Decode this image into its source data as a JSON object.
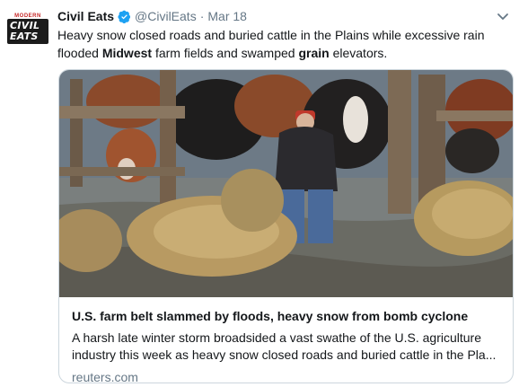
{
  "tweet": {
    "avatar": {
      "small_text": "MODERN",
      "logo_text": "CIVIL EATS"
    },
    "author_name": "Civil Eats",
    "handle": "@CivilEats",
    "separator": "·",
    "date": "Mar 18",
    "text_parts": [
      "Heavy snow closed roads and buried cattle in the Plains while excessive rain flooded ",
      "Midwest",
      " farm fields and swamped ",
      "grain",
      " elevators."
    ],
    "icons": {
      "verified": "verified-badge-icon",
      "menu": "chevron-down-icon"
    },
    "colors": {
      "verified": "#1da1f2",
      "muted": "#657786",
      "border": "#ccd6dd"
    }
  },
  "card": {
    "image_alt": "Flooded cattle pen with hay bales and a rancher wading in water",
    "title": "U.S. farm belt slammed by floods, heavy snow from bomb cyclone",
    "description": "A harsh late winter storm broadsided a vast swathe of the U.S. agriculture industry this week as heavy snow closed roads and buried cattle in the Pla...",
    "domain": "reuters.com"
  }
}
